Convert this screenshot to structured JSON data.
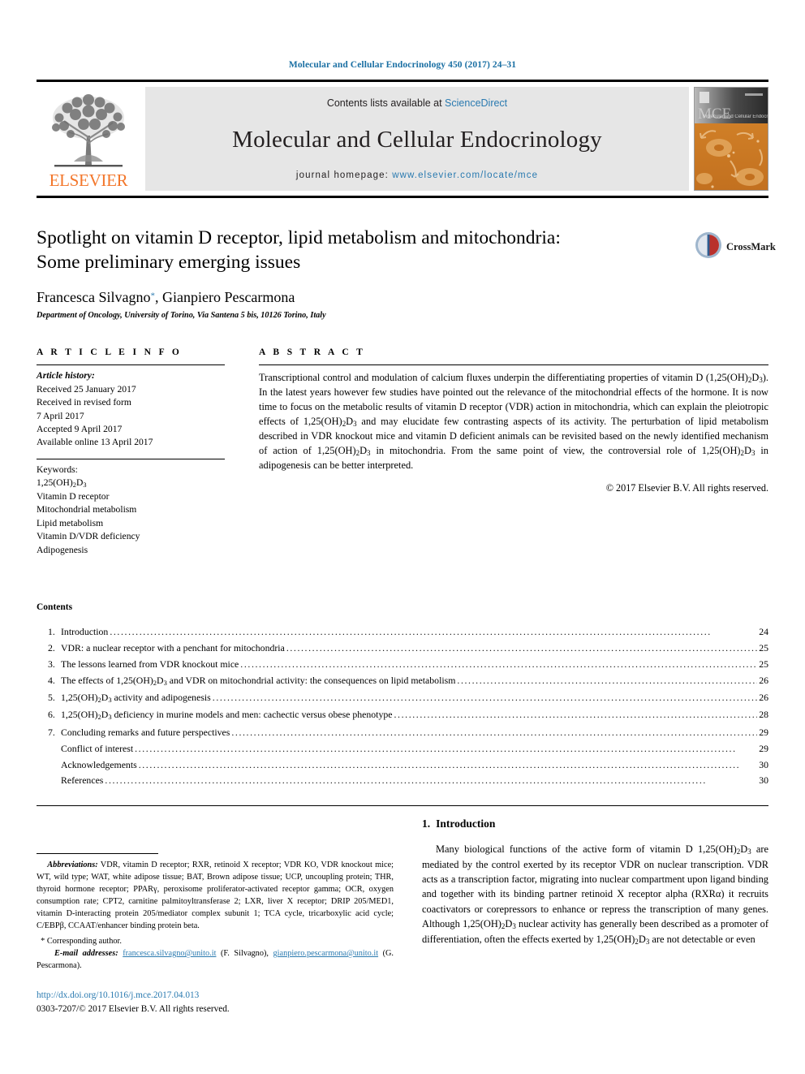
{
  "running_head": "Molecular and Cellular Endocrinology 450 (2017) 24–31",
  "masthead": {
    "publisher_name": "ELSEVIER",
    "contents_prefix": "Contents lists available at ",
    "contents_link": "ScienceDirect",
    "journal_title": "Molecular and Cellular Endocrinology",
    "homepage_label": "journal homepage: ",
    "homepage_url": "www.elsevier.com/locate/mce",
    "cover_caption": "MCE",
    "cover_subcaption": "Molecular and Cellular Endocrinology"
  },
  "article": {
    "title_line1": "Spotlight on vitamin D receptor, lipid metabolism and mitochondria:",
    "title_line2": "Some preliminary emerging issues",
    "authors": "Francesca Silvagno",
    "authors_rest": ", Gianpiero Pescarmona",
    "corresponding_marker": "*",
    "affiliation": "Department of Oncology, University of Torino, Via Santena 5 bis, 10126 Torino, Italy",
    "crossmark_label": "CrossMark"
  },
  "article_info": {
    "heading": "A R T I C L E  I N F O",
    "history_label": "Article history:",
    "history": [
      "Received 25 January 2017",
      "Received in revised form",
      "7 April 2017",
      "Accepted 9 April 2017",
      "Available online 13 April 2017"
    ],
    "keywords_label": "Keywords:",
    "keywords": [
      "1,25(OH)₂D₃",
      "Vitamin D receptor",
      "Mitochondrial metabolism",
      "Lipid metabolism",
      "Vitamin D/VDR deficiency",
      "Adipogenesis"
    ]
  },
  "abstract": {
    "heading": "A B S T R A C T",
    "text": "Transcriptional control and modulation of calcium fluxes underpin the differentiating properties of vitamin D (1,25(OH)₂D₃). In the latest years however few studies have pointed out the relevance of the mitochondrial effects of the hormone. It is now time to focus on the metabolic results of vitamin D receptor (VDR) action in mitochondria, which can explain the pleiotropic effects of 1,25(OH)₂D₃ and may elucidate few contrasting aspects of its activity. The perturbation of lipid metabolism described in VDR knockout mice and vitamin D deficient animals can be revisited based on the newly identified mechanism of action of 1,25(OH)₂D₃ in mitochondria. From the same point of view, the controversial role of 1,25(OH)₂D₃ in adipogenesis can be better interpreted.",
    "copyright": "© 2017 Elsevier B.V. All rights reserved."
  },
  "contents": {
    "heading": "Contents",
    "items": [
      {
        "num": "1.",
        "label": "Introduction",
        "page": "24"
      },
      {
        "num": "2.",
        "label": "VDR: a nuclear receptor with a penchant for mitochondria",
        "page": "25"
      },
      {
        "num": "3.",
        "label": "The lessons learned from VDR knockout mice",
        "page": "25"
      },
      {
        "num": "4.",
        "label": "The effects of 1,25(OH)₂D₃ and VDR on mitochondrial activity: the consequences on lipid metabolism",
        "page": "26"
      },
      {
        "num": "5.",
        "label": "1,25(OH)₂D₃ activity and adipogenesis",
        "page": "26"
      },
      {
        "num": "6.",
        "label": "1,25(OH)₂D₃ deficiency in murine models and men: cachectic versus obese phenotype",
        "page": "28"
      },
      {
        "num": "7.",
        "label": "Concluding remarks and future perspectives",
        "page": "29"
      },
      {
        "num": "",
        "label": "Conflict of interest",
        "page": "29"
      },
      {
        "num": "",
        "label": "Acknowledgements",
        "page": "30"
      },
      {
        "num": "",
        "label": "References",
        "page": "30"
      }
    ]
  },
  "footnotes": {
    "abbreviations_label": "Abbreviations:",
    "abbreviations_text": "VDR, vitamin D receptor; RXR, retinoid X receptor; VDR KO, VDR knockout mice; WT, wild type; WAT, white adipose tissue; BAT, Brown adipose tissue; UCP, uncoupling protein; THR, thyroid hormone receptor; PPARγ, peroxisome proliferator-activated receptor gamma; OCR, oxygen consumption rate; CPT2, carnitine palmitoyltransferase 2; LXR, liver X receptor; DRIP 205/MED1, vitamin D-interacting protein 205/mediator complex subunit 1; TCA cycle, tricarboxylic acid cycle; C/EBPβ, CCAAT/enhancer binding protein beta.",
    "corresponding_author": "Corresponding author.",
    "email_label": "E-mail addresses:",
    "email_1": "francesca.silvagno@unito.it",
    "email_1_owner": "(F. Silvagno),",
    "email_2": "gianpiero.pescarmona@unito.it",
    "email_2_owner": "(G. Pescarmona).",
    "doi": "http://dx.doi.org/10.1016/j.mce.2017.04.013",
    "issn": "0303-7207/© 2017 Elsevier B.V. All rights reserved."
  },
  "introduction": {
    "number": "1.",
    "heading": "Introduction",
    "paragraph": "Many biological functions of the active form of vitamin D 1,25(OH)₂D₃ are mediated by the control exerted by its receptor VDR on nuclear transcription. VDR acts as a transcription factor, migrating into nuclear compartment upon ligand binding and together with its binding partner retinoid X receptor alpha (RXRα) it recruits coactivators or corepressors to enhance or repress the transcription of many genes. Although 1,25(OH)₂D₃ nuclear activity has generally been described as a promoter of differentiation, often the effects exerted by 1,25(OH)₂D₃ are not detectable or even"
  },
  "colors": {
    "link": "#2a7ab0",
    "elsevier_orange": "#f3762a",
    "band_gray": "#e6e6e6"
  }
}
